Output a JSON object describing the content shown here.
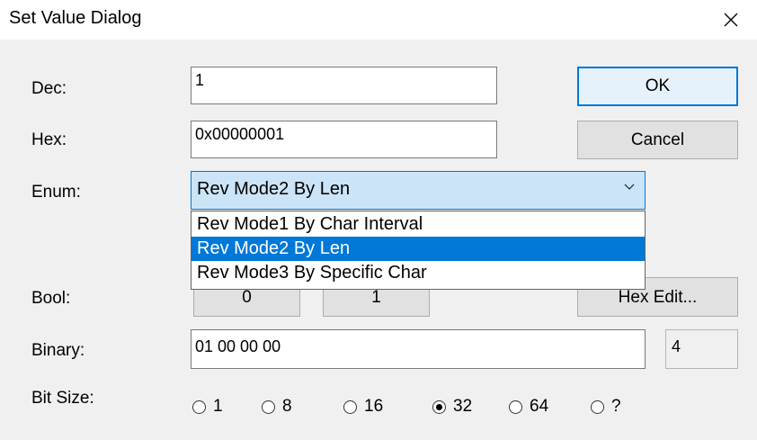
{
  "dialog": {
    "title": "Set Value Dialog"
  },
  "fields": {
    "dec_label": "Dec:",
    "dec_value": "1",
    "hex_label": "Hex:",
    "hex_value": "0x00000001",
    "enum_label": "Enum:",
    "enum_selected": "Rev Mode2 By Len",
    "enum_options": [
      "Rev Mode1 By Char Interval",
      "Rev Mode2 By Len",
      "Rev Mode3 By Specific Char"
    ],
    "bool_label": "Bool:",
    "bool_false": "0",
    "bool_true": "1",
    "binary_label": "Binary:",
    "binary_value": "01 00 00 00",
    "binary_size": "4",
    "bitsize_label": "Bit Size:",
    "bitsize_options": [
      "1",
      "8",
      "16",
      "32",
      "64",
      "?"
    ],
    "bitsize_selected": "32"
  },
  "buttons": {
    "ok": "OK",
    "cancel": "Cancel",
    "hex_edit": "Hex Edit..."
  },
  "colors": {
    "accent": "#0078d7",
    "combo_bg": "#cce4f7",
    "dialog_bg": "#f0f0f0"
  }
}
